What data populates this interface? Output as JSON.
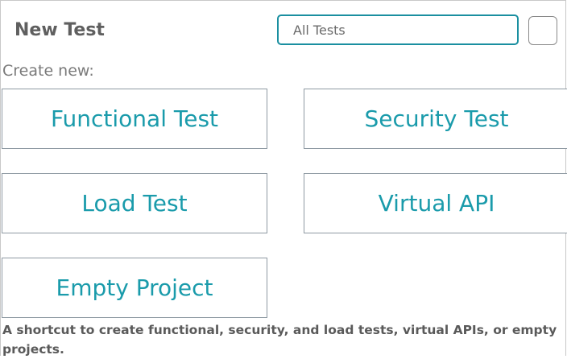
{
  "dialog": {
    "title": "New Test",
    "search": {
      "value": "",
      "placeholder": "All Tests"
    },
    "create_label": "Create new:",
    "tiles": [
      {
        "label": "Functional Test"
      },
      {
        "label": "Security Test"
      },
      {
        "label": "Load Test"
      },
      {
        "label": "Virtual API"
      },
      {
        "label": "Empty Project"
      }
    ],
    "description": "A shortcut to create functional, security, and load tests, virtual APIs, or empty projects."
  },
  "colors": {
    "accent": "#1a9bab",
    "search_border": "#1a8fa0",
    "tile_border": "#8f9aa3",
    "text": "#5a5a5a"
  }
}
